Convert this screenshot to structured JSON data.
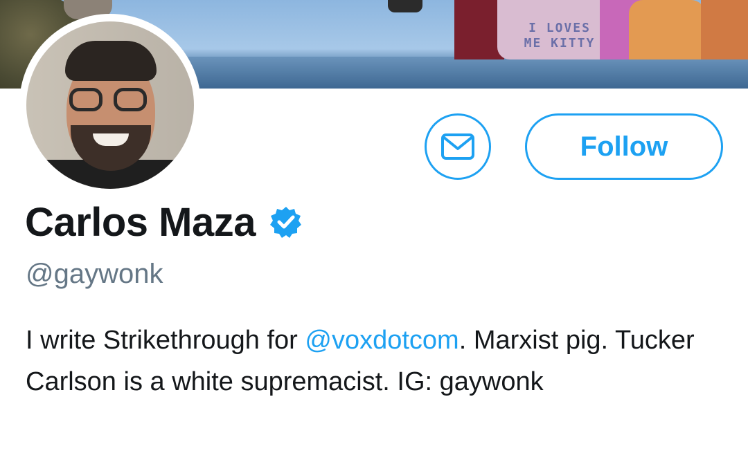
{
  "banner": {
    "shirt_text": "I LOVES ME KITTY"
  },
  "profile": {
    "display_name": "Carlos Maza",
    "handle": "@gaywonk",
    "verified": true,
    "bio": {
      "prefix": "I write Strikethrough for ",
      "mention": "@voxdotcom",
      "suffix": ". Marxist pig. Tucker Carlson is a white supremacist. IG: gaywonk"
    }
  },
  "actions": {
    "follow_label": "Follow",
    "message_icon": "envelope-icon"
  },
  "colors": {
    "accent": "#1da1f2",
    "text": "#14171a",
    "muted": "#657786"
  }
}
